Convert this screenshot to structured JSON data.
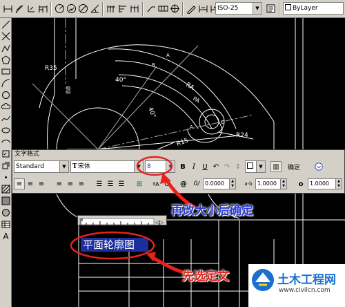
{
  "top_toolbar": {
    "dim_style": "ISO-25",
    "layer_name": "ByLayer"
  },
  "drawing": {
    "dims": [
      "R35",
      "88",
      "40°",
      "40°",
      "B",
      "A",
      "C",
      "R24",
      "R15",
      "RA",
      "PA",
      "A"
    ],
    "text": "R25"
  },
  "text_format": {
    "title": "文字格式",
    "style": "Standard",
    "font": "宋体",
    "font_prefix": "T",
    "height": "8",
    "bold": "B",
    "italic": "I",
    "underline": "U",
    "ok_label": "确定",
    "oblique_label": "0/",
    "oblique": "0.0000",
    "tracking_label": "a-b",
    "tracking": "1.0000",
    "width_label": "o",
    "width_factor": "1.0000",
    "at_symbol": "@",
    "stack_label": "A"
  },
  "editor": {
    "mtext": "平面轮廓图"
  },
  "annotations": {
    "resize_confirm": "再改大小后确定",
    "select_first": "先选定文"
  },
  "watermark": {
    "site_name": "土木工程网",
    "url": "www.civilcn.com"
  },
  "colors": {
    "annotation_red": "#e8211c",
    "annotation_blue": "#2a3bd6",
    "selection_blue": "#1c2e9c",
    "toolbar_gray": "#d4d0c8"
  }
}
